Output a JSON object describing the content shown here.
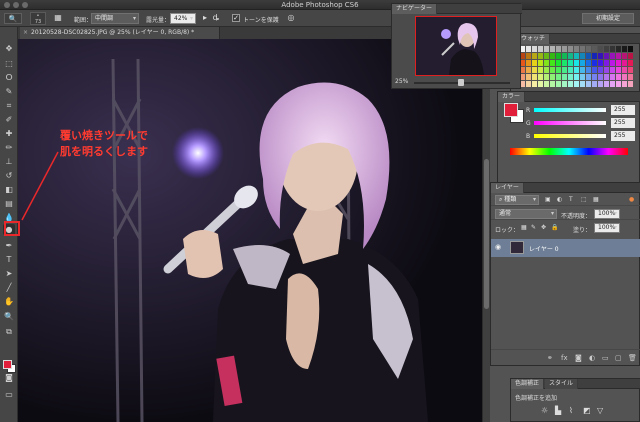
{
  "app": {
    "title": "Adobe Photoshop CS6"
  },
  "options_bar": {
    "tool_icon": "🔍",
    "brush_size": "73",
    "range_label": "範囲：",
    "range_value": "中間調",
    "exposure_label": "露光量：",
    "exposure_value": "42%",
    "protect_tones_label": "トーンを保護",
    "protect_tones_checked": "✓",
    "workspace_label": "初期設定"
  },
  "document_tab": {
    "close": "×",
    "title": "20120528-DSC02825.JPG @ 25% (レイヤー 0, RGB/8) *"
  },
  "annotation": {
    "line1": "覆い焼きツールで",
    "line2": "肌を明るくします"
  },
  "navigator": {
    "tab_label": "ナビゲーター",
    "zoom": "25%"
  },
  "swatches": {
    "tab_label": "スウォッチ"
  },
  "color_panel": {
    "tab_label": "カラー",
    "r_label": "R",
    "r_value": "255",
    "g_label": "G",
    "g_value": "255",
    "b_label": "B",
    "b_value": "255",
    "fg_color": "#e21f3a",
    "bg_color": "#ffffff"
  },
  "layers_panel": {
    "tab_label": "レイヤー",
    "filter_label": "種類",
    "blend_mode": "通常",
    "opacity_label": "不透明度：",
    "opacity_value": "100%",
    "lock_label": "ロック：",
    "fill_label": "塗り：",
    "fill_value": "100%",
    "layer_name": "レイヤー 0"
  },
  "adjustments_panel": {
    "tab_label": "色調補正",
    "tab_styles": "スタイル",
    "subtitle": "色調補正を追加"
  }
}
